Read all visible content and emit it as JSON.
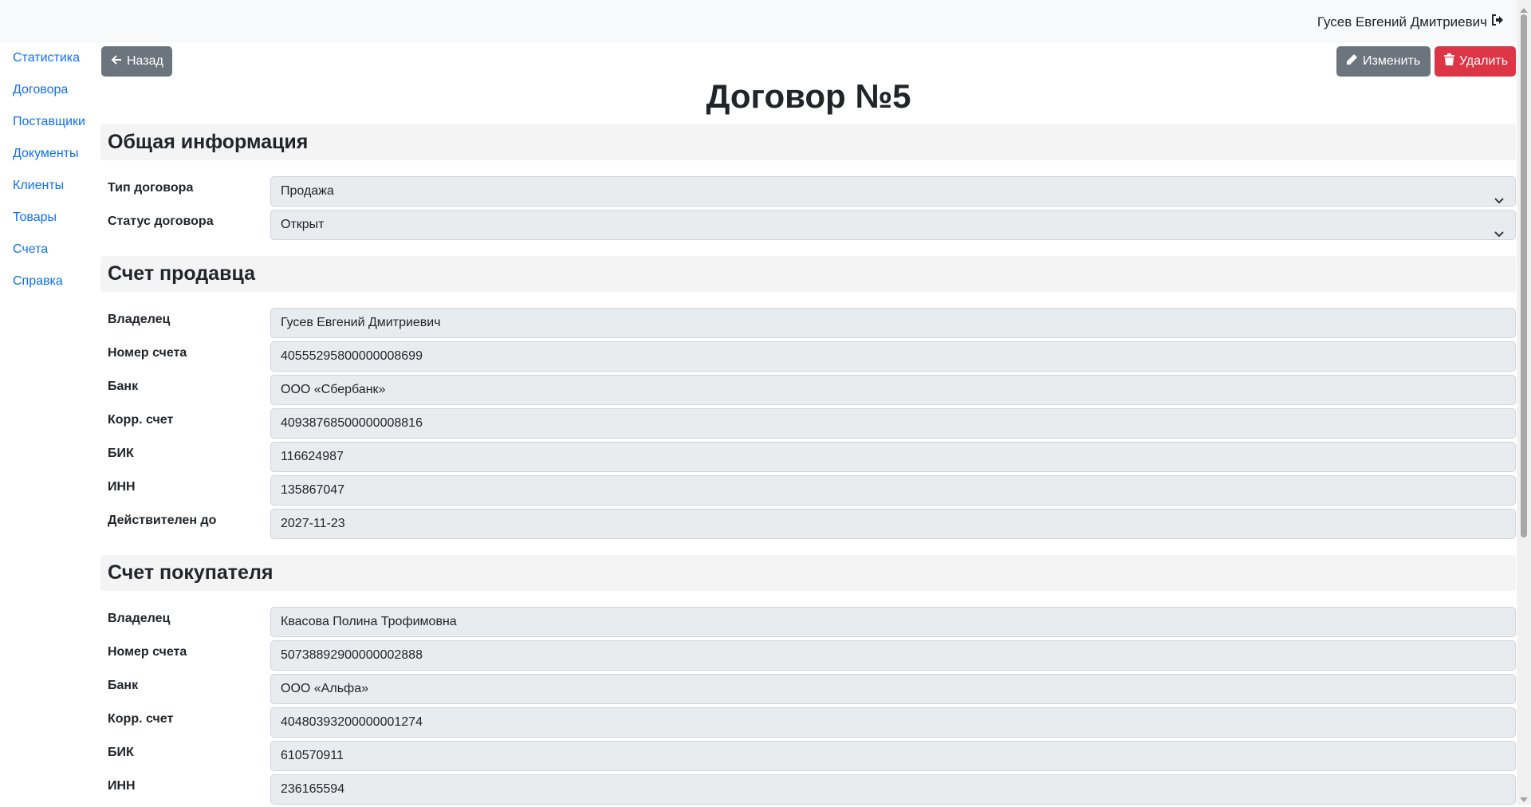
{
  "header": {
    "user_name": "Гусев Евгений Дмитриевич",
    "logout_icon": "sign-out-icon"
  },
  "sidebar": {
    "items": [
      {
        "label": "Статистика"
      },
      {
        "label": "Договора"
      },
      {
        "label": "Поставщики"
      },
      {
        "label": "Документы"
      },
      {
        "label": "Клиенты"
      },
      {
        "label": "Товары"
      },
      {
        "label": "Счета"
      },
      {
        "label": "Справка"
      }
    ]
  },
  "toolbar": {
    "back_label": "Назад",
    "edit_label": "Изменить",
    "delete_label": "Удалить"
  },
  "page": {
    "title": "Договор №5"
  },
  "general": {
    "title": "Общая информация",
    "contract_type_label": "Тип договора",
    "contract_type_value": "Продажа",
    "contract_status_label": "Статус договора",
    "contract_status_value": "Открыт"
  },
  "seller": {
    "title": "Счет продавца",
    "fields": [
      {
        "label": "Владелец",
        "value": "Гусев Евгений Дмитриевич"
      },
      {
        "label": "Номер счета",
        "value": "40555295800000008699"
      },
      {
        "label": "Банк",
        "value": "ООО «Сбербанк»"
      },
      {
        "label": "Корр. счет",
        "value": "40938768500000008816"
      },
      {
        "label": "БИК",
        "value": "116624987"
      },
      {
        "label": "ИНН",
        "value": "135867047"
      },
      {
        "label": "Действителен до",
        "value": "2027-11-23"
      }
    ]
  },
  "buyer": {
    "title": "Счет покупателя",
    "fields": [
      {
        "label": "Владелец",
        "value": "Квасова Полина Трофимовна"
      },
      {
        "label": "Номер счета",
        "value": "50738892900000002888"
      },
      {
        "label": "Банк",
        "value": "ООО «Альфа»"
      },
      {
        "label": "Корр. счет",
        "value": "40480393200000001274"
      },
      {
        "label": "БИК",
        "value": "610570911"
      },
      {
        "label": "ИНН",
        "value": "236165594"
      }
    ]
  },
  "colors": {
    "link": "#0d6efd",
    "secondary": "#6c757d",
    "danger": "#dc3545",
    "field_bg": "#e9ecef"
  }
}
